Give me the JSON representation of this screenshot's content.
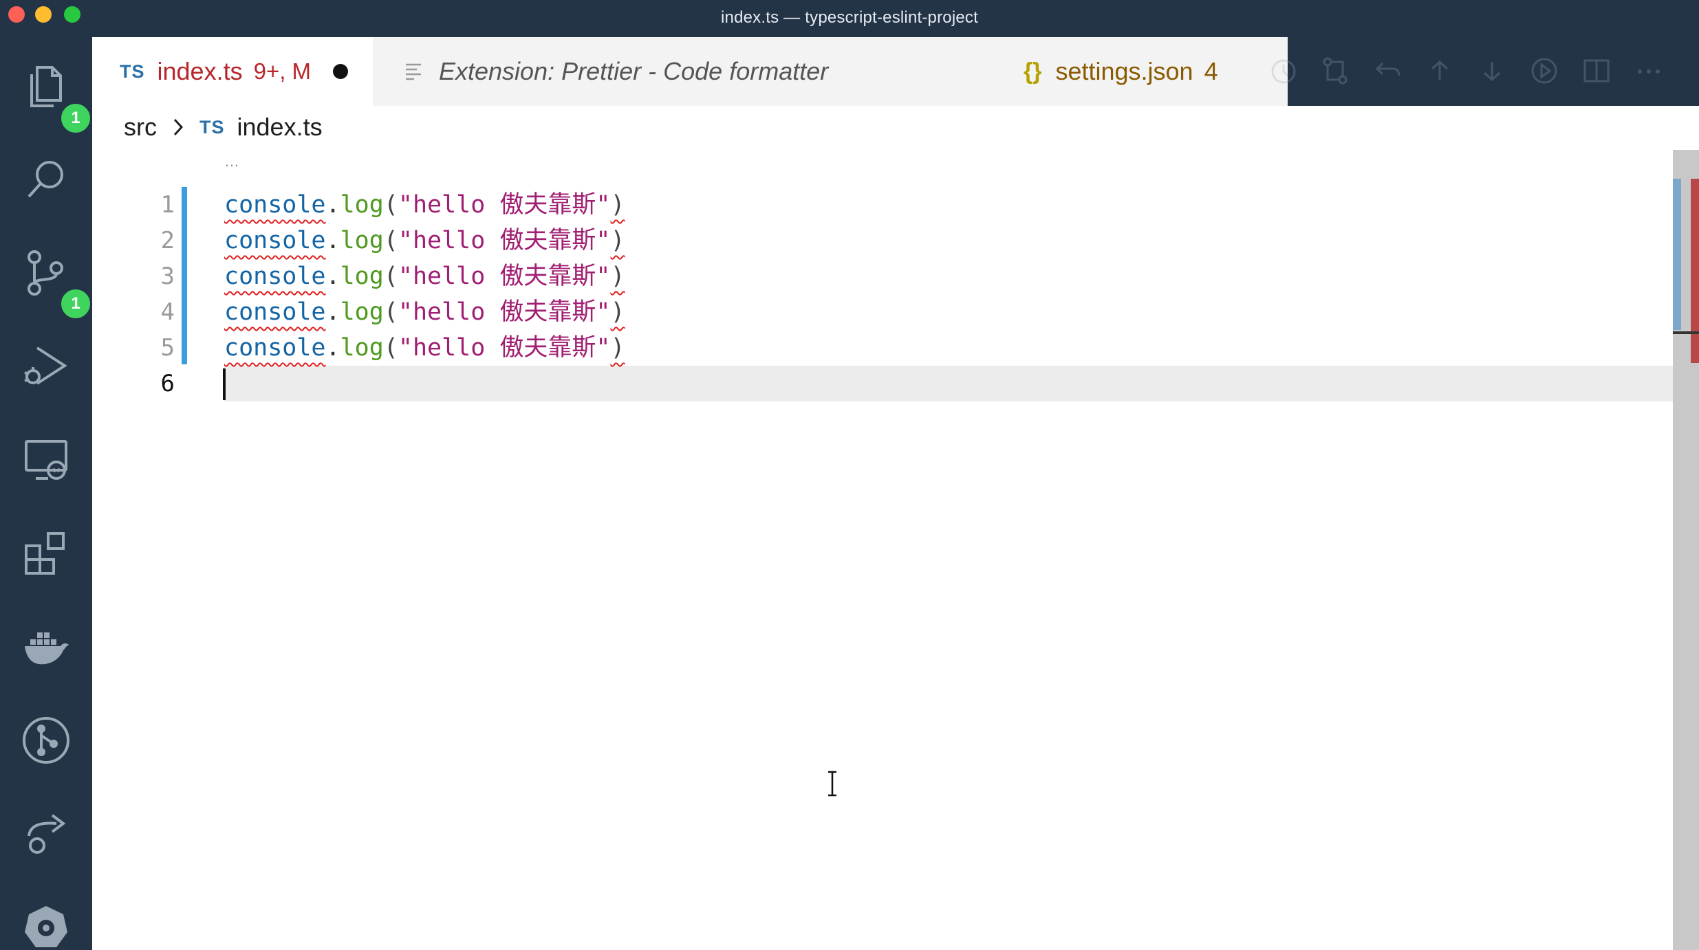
{
  "window": {
    "title": "index.ts — typescript-eslint-project"
  },
  "activity_bar": {
    "items": [
      {
        "icon": "files-icon",
        "badge": "1"
      },
      {
        "icon": "search-icon"
      },
      {
        "icon": "source-control-icon",
        "badge": "1"
      },
      {
        "icon": "run-debug-icon"
      },
      {
        "icon": "remote-explorer-icon"
      },
      {
        "icon": "extensions-icon"
      },
      {
        "icon": "docker-icon"
      },
      {
        "icon": "git-graph-icon"
      },
      {
        "icon": "live-share-icon"
      },
      {
        "icon": "kubernetes-icon"
      }
    ]
  },
  "tabs": {
    "active": {
      "lang_icon": "TS",
      "name": "index.ts",
      "meta": "9+, M"
    },
    "extension": {
      "name": "Extension: Prettier - Code formatter"
    },
    "settings": {
      "icon": "{}",
      "name": "settings.json",
      "count": "4"
    }
  },
  "breadcrumb": {
    "folder": "src",
    "lang_icon": "TS",
    "file": "index.ts"
  },
  "editor": {
    "fold_ellipsis": "…",
    "line_numbers": [
      "1",
      "2",
      "3",
      "4",
      "5",
      "6"
    ],
    "code": {
      "object": "console",
      "dot": ".",
      "method": "log",
      "open_paren": "(",
      "string": "\"hello 傲夫靠斯\"",
      "close_paren": ")"
    }
  },
  "colors": {
    "chrome": "#243447",
    "badge": "#3fd45e",
    "modified": "#b8262b",
    "keyword": "#1465a5",
    "method": "#4e9a1f",
    "string": "#a11f72",
    "diff_bar": "#3d9be0",
    "error_squiggle": "#e02020"
  }
}
